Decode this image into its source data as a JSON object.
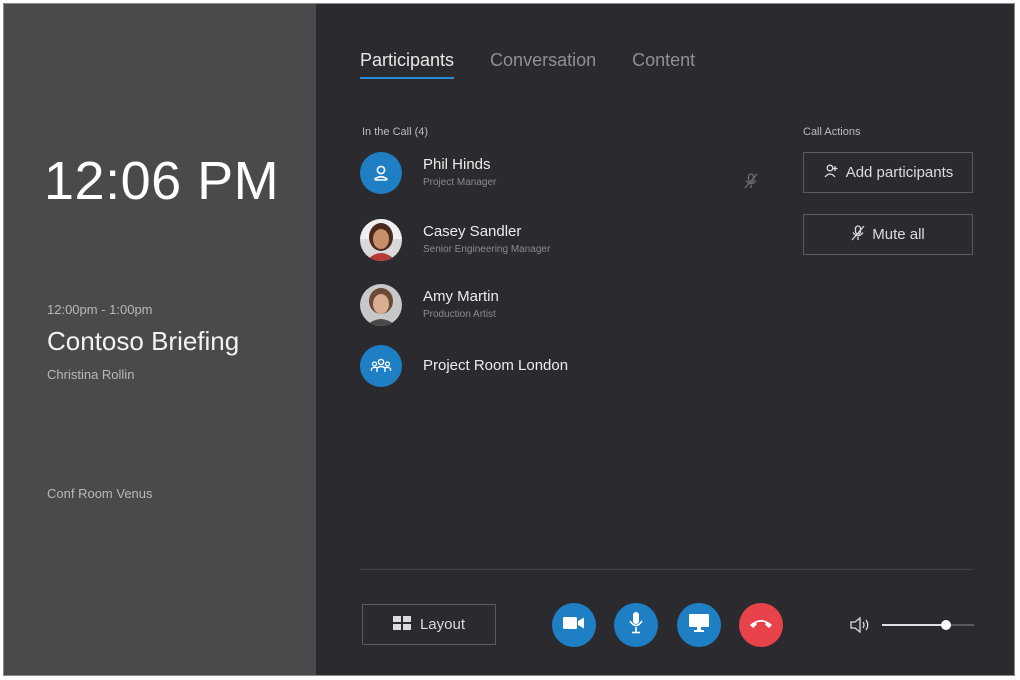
{
  "left_panel": {
    "clock": "12:06 PM",
    "meeting_time": "12:00pm - 1:00pm",
    "meeting_title": "Contoso Briefing",
    "organizer": "Christina Rollin",
    "room": "Conf Room Venus"
  },
  "tabs": [
    {
      "label": "Participants",
      "active": true
    },
    {
      "label": "Conversation",
      "active": false
    },
    {
      "label": "Content",
      "active": false
    }
  ],
  "participants_section": {
    "label": "In the Call (4)",
    "items": [
      {
        "name": "Phil Hinds",
        "role": "Project Manager",
        "avatar": "person-icon",
        "muted": true
      },
      {
        "name": "Casey Sandler",
        "role": "Senior Engineering Manager",
        "avatar": "photo"
      },
      {
        "name": "Amy Martin",
        "role": "Production Artist",
        "avatar": "photo"
      },
      {
        "name": "Project Room London",
        "role": "",
        "avatar": "room-icon"
      }
    ]
  },
  "call_actions": {
    "label": "Call Actions",
    "add_participants": "Add participants",
    "mute_all": "Mute all"
  },
  "toolbar": {
    "layout_label": "Layout",
    "volume_level": 0.7
  },
  "colors": {
    "accent": "#1f7fc4",
    "hangup": "#e8424b",
    "left_panel_bg": "#4a4a4c",
    "right_panel_bg": "#2b2b2f"
  }
}
